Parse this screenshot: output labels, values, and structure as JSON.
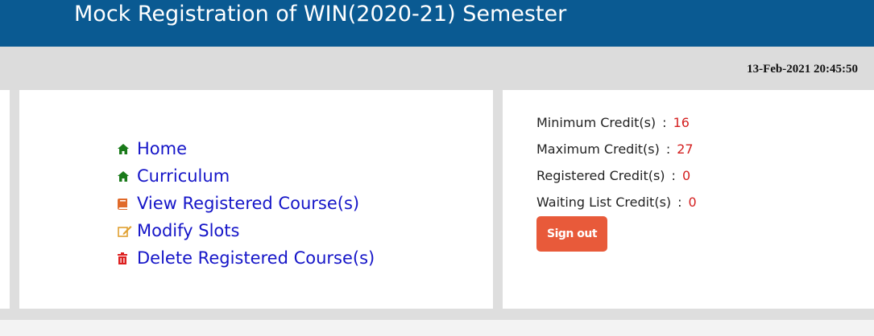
{
  "header": {
    "title": "Mock Registration of WIN(2020-21) Semester"
  },
  "datebar": {
    "datetime": "13-Feb-2021 20:45:50"
  },
  "nav": {
    "items": [
      {
        "label": "Home",
        "icon": "home-icon"
      },
      {
        "label": "Curriculum",
        "icon": "home-icon"
      },
      {
        "label": "View Registered Course(s)",
        "icon": "book-icon"
      },
      {
        "label": "Modify Slots",
        "icon": "edit-icon"
      },
      {
        "label": "Delete Registered Course(s)",
        "icon": "trash-icon"
      }
    ]
  },
  "credits": {
    "rows": [
      {
        "label": "Minimum Credit(s)",
        "sep": ":",
        "value": "16"
      },
      {
        "label": "Maximum Credit(s)",
        "sep": ":",
        "value": "27"
      },
      {
        "label": "Registered Credit(s)",
        "sep": ":",
        "value": "0"
      },
      {
        "label": "Waiting List Credit(s)",
        "sep": ":",
        "value": "0"
      }
    ],
    "signout_label": "Sign out"
  },
  "colors": {
    "header_bg": "#0a5a92",
    "link": "#1515c8",
    "value_red": "#d42020",
    "signout_bg": "#e85a3a",
    "home_icon": "#1a7a1a",
    "book_icon": "#e06a2a",
    "edit_icon": "#e0a030",
    "trash_icon": "#dd2020"
  }
}
